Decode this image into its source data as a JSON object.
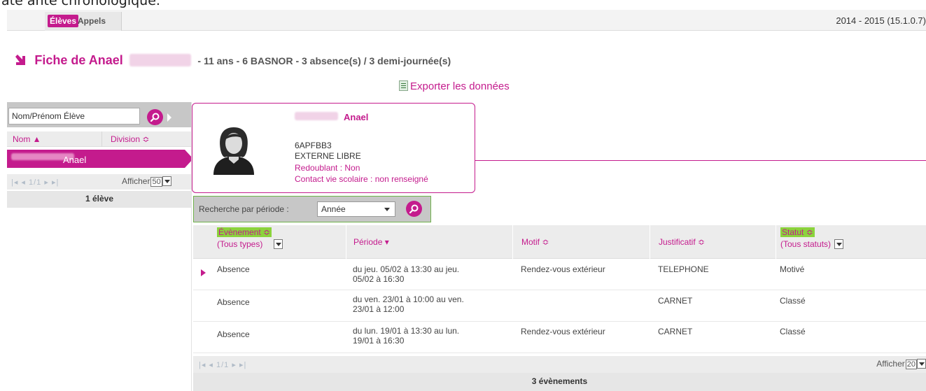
{
  "caption": "ate ante chronologique.",
  "tabs": [
    {
      "label": "Élèves"
    },
    {
      "label": "Appels"
    }
  ],
  "version": "2014 - 2015   (15.1.0.7)",
  "title": {
    "prefix": "Fiche de Anael",
    "suffix": "- 11 ans - 6 BASNOR - 3 absence(s) / 3 demi-journée(s)"
  },
  "export_label": "Exporter les données",
  "left_panel": {
    "search_placeholder": "Nom/Prénom Élève",
    "columns": {
      "nom": "Nom ▲",
      "division": "Division ≎"
    },
    "selected_row": {
      "name": "Anael"
    },
    "pager": "|◂ ◂ 1/1 ▸ ▸|",
    "afficher_label": "Afficher",
    "afficher_value": "50",
    "count": "1 élève"
  },
  "card": {
    "first_name": "Anael",
    "id": "6APFBB3",
    "regime": "EXTERNE LIBRE",
    "redoublant": "Redoublant : Non",
    "contact": "Contact vie scolaire : non renseigné"
  },
  "period_search": {
    "label": "Recherche par période :",
    "value": "Année"
  },
  "table": {
    "headers": {
      "evenement": "Évènement ≎",
      "evenement_filter": "(Tous types)",
      "periode": "Période ▾",
      "motif": "Motif ≎",
      "justificatif": "Justificatif ≎",
      "statut": "Statut ≎",
      "statut_filter": "(Tous statuts)"
    },
    "rows": [
      {
        "evenement": "Absence",
        "periode1": "du jeu. 05/02 à 13:30 au jeu.",
        "periode2": "05/02 à 16:30",
        "motif": "Rendez-vous extérieur",
        "justificatif": "TELEPHONE",
        "statut": "Motivé"
      },
      {
        "evenement": "Absence",
        "periode1": "du ven. 23/01 à 10:00 au ven.",
        "periode2": "23/01 à 12:00",
        "motif": "",
        "justificatif": "CARNET",
        "statut": "Classé"
      },
      {
        "evenement": "Absence",
        "periode1": "du lun. 19/01 à 13:30 au lun.",
        "periode2": "19/01 à 16:30",
        "motif": "Rendez-vous extérieur",
        "justificatif": "CARNET",
        "statut": "Classé"
      }
    ],
    "pager": "|◂ ◂ 1/1 ▸ ▸|",
    "afficher_label": "Afficher",
    "afficher_value": "20",
    "count": "3 évènements"
  },
  "colors": {
    "accent": "#c41b8d",
    "highlight": "#8bd33c"
  }
}
